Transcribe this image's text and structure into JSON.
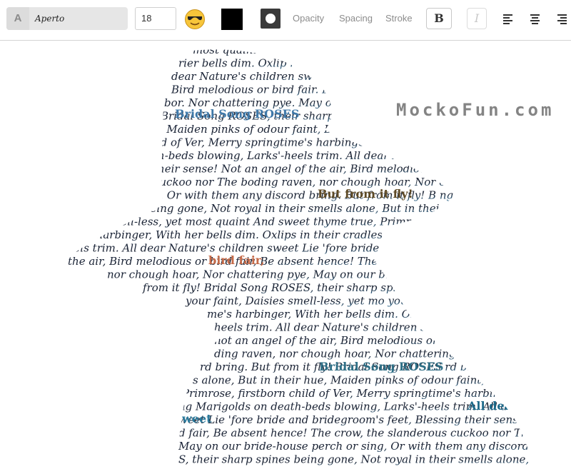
{
  "toolbar": {
    "font_icon_letter": "A",
    "font_name": "Aperto",
    "font_size": "18",
    "emoji_icon": "sunglasses-emoji-icon",
    "text_color": "#000000",
    "shape_icon": "circle-shape-icon",
    "opacity_label": "Opacity",
    "spacing_label": "Spacing",
    "stroke_label": "Stroke",
    "bold_label": "B",
    "italic_label": "I",
    "align_left_icon": "align-left-icon",
    "align_center_icon": "align-center-icon",
    "align_right_icon": "align-right-icon"
  },
  "canvas": {
    "watermark": "MockoFun.com",
    "art_description_icon": "woman-silhouette-word-art",
    "lines": [
      "most quaint And sweet thyme",
      "rier bells dim. Oxlip",
      "dear Nature's children swee",
      "Bird melodious or bird fair. Be",
      "bor. Nor chattering pye. May on",
      "Bridal Song ROSES, their sharp",
      "e. Maiden pinks of odour faint, Daisies smell-less",
      "ild of Ver, Merry springtime's harbinger, With her bel",
      "th-beds blowing, Larks'-heels trim. All dear Nature's chi",
      "their sense! Not an angel of the air, Bird melodious or bi",
      "cuckoo nor The boding raven, nor chough hoar, Nor chattering",
      "ng. Or with them any discord bring. But from it fly! B",
      "sharp spines being gone, Not royal in their smells alone, But in thei",
      "aisies smell-less, yet most quaint And sweet thyme true, Primrose",
      "me's harbinger, With her bells dim. Oxlips in their cradles growing",
      "heels trim. All dear Nature's children sweet Lie 'fore bride and b",
      "the air, Bird melodious or bird fair, Be absent hence! The",
      "nor chough hoar, Nor chattering pye, May on our bride-house",
      "from it fly! Bridal Song ROSES, their sharp spines bei",
      "your faint, Daisies smell-less, yet mo",
      "me's harbinger, With her bells dim. Ox",
      "heels trim. All dear Nature's children sw",
      "not an angel of the air, Bird melodious or bird fa",
      "ding raven, nor chough hoar, Nor chattering pye, May",
      "rd bring. But from it fly! Bridal Song ROSES",
      "s alone, But in their hue, Maiden pinks of odour faint, Daisies",
      "Primrose, firstborn child of Ver, Merry springtime's harbinger, Wi",
      "ng Marigolds on death-beds blowing, Larks'-heels trim. All dea",
      "weet Lie 'fore bride and bridegroom's feet, Blessing their sense! Not a",
      "d fair, Be absent hence! The crow, the slanderous cuckoo nor The boding r",
      "May on our bride-house perch or sing, Or with them any discord bring",
      "S, their sharp spines being gone, Not royal in their smells alone, But in thei"
    ],
    "highlights": [
      {
        "text": "Bridal Song ROSES",
        "color": "#3f79a9"
      },
      {
        "text": "But from it fly!",
        "color": "#5e4a26"
      },
      {
        "text": "bird fair,",
        "color": "#c56a48"
      },
      {
        "text": "Bridal Song ROSES",
        "color": "#2e6f86"
      },
      {
        "text": "All dea",
        "color": "#1d6a8a"
      },
      {
        "text": "weet",
        "color": "#2a7a9c"
      }
    ]
  }
}
